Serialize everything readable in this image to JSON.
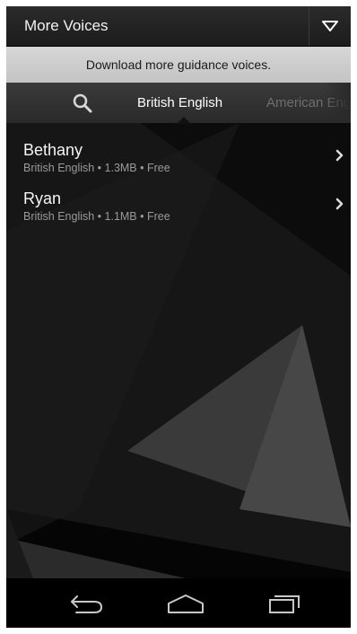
{
  "header": {
    "title": "More Voices",
    "menu_icon": "dropdown-menu-icon"
  },
  "banner": {
    "text": "Download more guidance voices."
  },
  "tabs": {
    "search_icon": "search-icon",
    "items": [
      {
        "label": "British English",
        "active": true
      },
      {
        "label": "American English",
        "active": false
      }
    ]
  },
  "voices": [
    {
      "name": "Bethany",
      "details": "British English • 1.3MB • Free"
    },
    {
      "name": "Ryan",
      "details": "British English • 1.1MB • Free"
    }
  ],
  "navbar": {
    "icons": [
      "back-icon",
      "home-icon",
      "recent-apps-icon"
    ]
  },
  "colors": {
    "background": "#050505",
    "banner": "#cfcfcf",
    "tabbar": "#333333",
    "text_primary": "#f5f5f5",
    "text_secondary": "#9a9a9a"
  }
}
